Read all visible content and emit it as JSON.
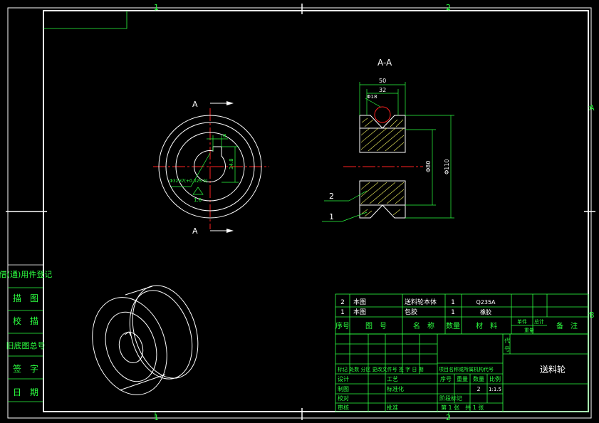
{
  "sheet": {
    "zone_top_left": "1",
    "zone_top_right": "2",
    "zone_bottom_left": "1",
    "zone_bottom_right": "2",
    "zone_right_a": "A",
    "zone_right_b": "B"
  },
  "left_strip": [
    "借(通)用件登记",
    "描　图",
    "校　描",
    "旧底图总号",
    "签　字",
    "日　期"
  ],
  "front_view": {
    "section_mark_top": "A",
    "section_mark_bottom": "A",
    "dim_key_width": "8",
    "dim_key_depth": "34.8",
    "dim_bore": "Φ32H7(+0.025 0)",
    "surface_mark": "1.6"
  },
  "section_view": {
    "title": "A-A",
    "dim_width": "50",
    "dim_inner_width": "32",
    "dim_groove": "Φ18",
    "dim_hub": "Φ80",
    "dim_outer": "Φ110",
    "leader_2": "2",
    "leader_1": "1"
  },
  "bom": {
    "rows": [
      {
        "no": "2",
        "drawing": "本图",
        "name": "送料轮本体",
        "qty": "1",
        "material": "Q235A"
      },
      {
        "no": "1",
        "drawing": "本图",
        "name": "包胶",
        "qty": "1",
        "material": "橡胶"
      }
    ],
    "header": {
      "no": "序号",
      "drawing": "图　号",
      "name": "名　称",
      "qty": "数量",
      "material": "材　料",
      "unit_weight": "单件",
      "total_weight": "总计",
      "weight": "重量",
      "remarks": "备　注"
    }
  },
  "title_block": {
    "part_name": "送料轮",
    "rev_row": "标记 处数 分区 更改文件号 签 字 日 期",
    "spec": "项目名称或所属机构代号",
    "design": "设计",
    "draw": "制图",
    "check": "校对",
    "review": "审核",
    "process": "工艺",
    "standard": "标准化",
    "approve": "批准",
    "seq": "序号",
    "weight": "重量",
    "count": "数量",
    "scale": "比例",
    "count_value": "2",
    "scale_value": "1:1.5",
    "stage": "阶段标记",
    "sheet_info": "第 1 张　共 1 张",
    "unit_col": [
      "代",
      "号"
    ]
  }
}
